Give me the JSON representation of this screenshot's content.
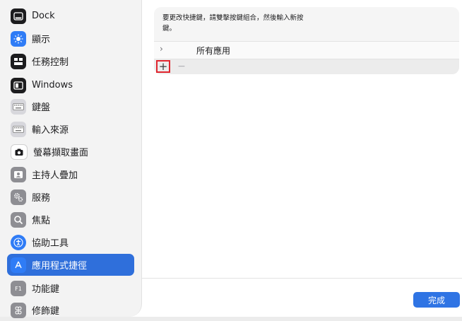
{
  "sidebar": {
    "items": [
      {
        "label": "Dock",
        "icon": "dock-icon",
        "selected": false
      },
      {
        "label": "顯示",
        "icon": "brightness-icon",
        "selected": false
      },
      {
        "label": "任務控制",
        "icon": "mission-control-icon",
        "selected": false
      },
      {
        "label": "Windows",
        "icon": "windows-icon",
        "selected": false
      },
      {
        "label": "鍵盤",
        "icon": "keyboard-icon",
        "selected": false
      },
      {
        "label": "輸入來源",
        "icon": "input-sources-icon",
        "selected": false
      },
      {
        "label": "螢幕擷取畫面",
        "icon": "screenshot-icon",
        "selected": false
      },
      {
        "label": "主持人疊加",
        "icon": "presenter-overlay-icon",
        "selected": false
      },
      {
        "label": "服務",
        "icon": "services-gear-icon",
        "selected": false
      },
      {
        "label": "焦點",
        "icon": "focus-magnifier-icon",
        "selected": false
      },
      {
        "label": "協助工具",
        "icon": "accessibility-icon",
        "selected": false
      },
      {
        "label": "應用程式捷徑",
        "icon": "app-shortcuts-icon",
        "selected": true
      },
      {
        "label": "功能鍵",
        "icon": "function-keys-icon",
        "selected": false
      },
      {
        "label": "修飾鍵",
        "icon": "modifier-keys-icon",
        "selected": false
      }
    ]
  },
  "main": {
    "instruction": "要更改快捷鍵，請雙擊按鍵組合，然後輸入新按鍵。",
    "app_row_label": "所有應用",
    "add_label": "+",
    "remove_label": "−",
    "chevron": "›"
  },
  "footer": {
    "done_label": "完成"
  },
  "colors": {
    "accent": "#2f6fdb",
    "highlight_box": "#e0262f"
  }
}
